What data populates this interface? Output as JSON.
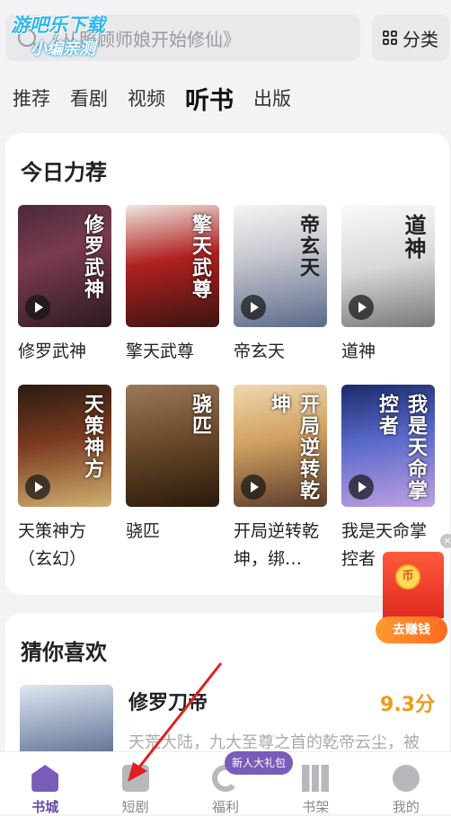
{
  "search": {
    "placeholder": "《从照顾师娘开始修仙》"
  },
  "watermark": {
    "line1": "游吧乐下载",
    "line2": "小编亲测"
  },
  "category_button": {
    "label": "分类"
  },
  "tabs": [
    {
      "label": "推荐",
      "active": false
    },
    {
      "label": "看剧",
      "active": false
    },
    {
      "label": "视频",
      "active": false
    },
    {
      "label": "听书",
      "active": true
    },
    {
      "label": "出版",
      "active": false
    }
  ],
  "today_picks": {
    "title": "今日力荐",
    "books": [
      {
        "title": "修罗武神",
        "cover_text": "修罗武神"
      },
      {
        "title": "擎天武尊",
        "cover_text": "擎天武尊"
      },
      {
        "title": "帝玄天",
        "cover_text": "帝玄天"
      },
      {
        "title": "道神",
        "cover_text": "道神"
      },
      {
        "title": "天策神方（玄幻）",
        "cover_text": "天策神方"
      },
      {
        "title": "骁匹",
        "cover_text": "骁匹"
      },
      {
        "title": "开局逆转乾坤，绑…",
        "cover_text": "开局逆转乾坤"
      },
      {
        "title": "我是天命掌控者",
        "cover_text": "我是天命掌控者"
      }
    ]
  },
  "guess": {
    "title": "猜你喜欢",
    "item": {
      "title": "修罗刀帝",
      "score": "9.3分",
      "desc": "天荒大陆，九大至尊之首的乾帝云尘，被"
    }
  },
  "earn": {
    "label": "去赚钱",
    "coin_text": "币",
    "close": "×"
  },
  "bottom_nav": {
    "items": [
      {
        "label": "书城",
        "icon": "home-icon",
        "active": true
      },
      {
        "label": "短剧",
        "icon": "drama-icon",
        "active": false
      },
      {
        "label": "福利",
        "icon": "welfare-icon",
        "active": false
      },
      {
        "label": "书架",
        "icon": "shelf-icon",
        "active": false
      },
      {
        "label": "我的",
        "icon": "profile-icon",
        "active": false
      }
    ],
    "badge": "新人大礼包"
  },
  "colors": {
    "accent": "#7a5cba",
    "score": "#f09a1a",
    "annotation": "#e02020"
  }
}
